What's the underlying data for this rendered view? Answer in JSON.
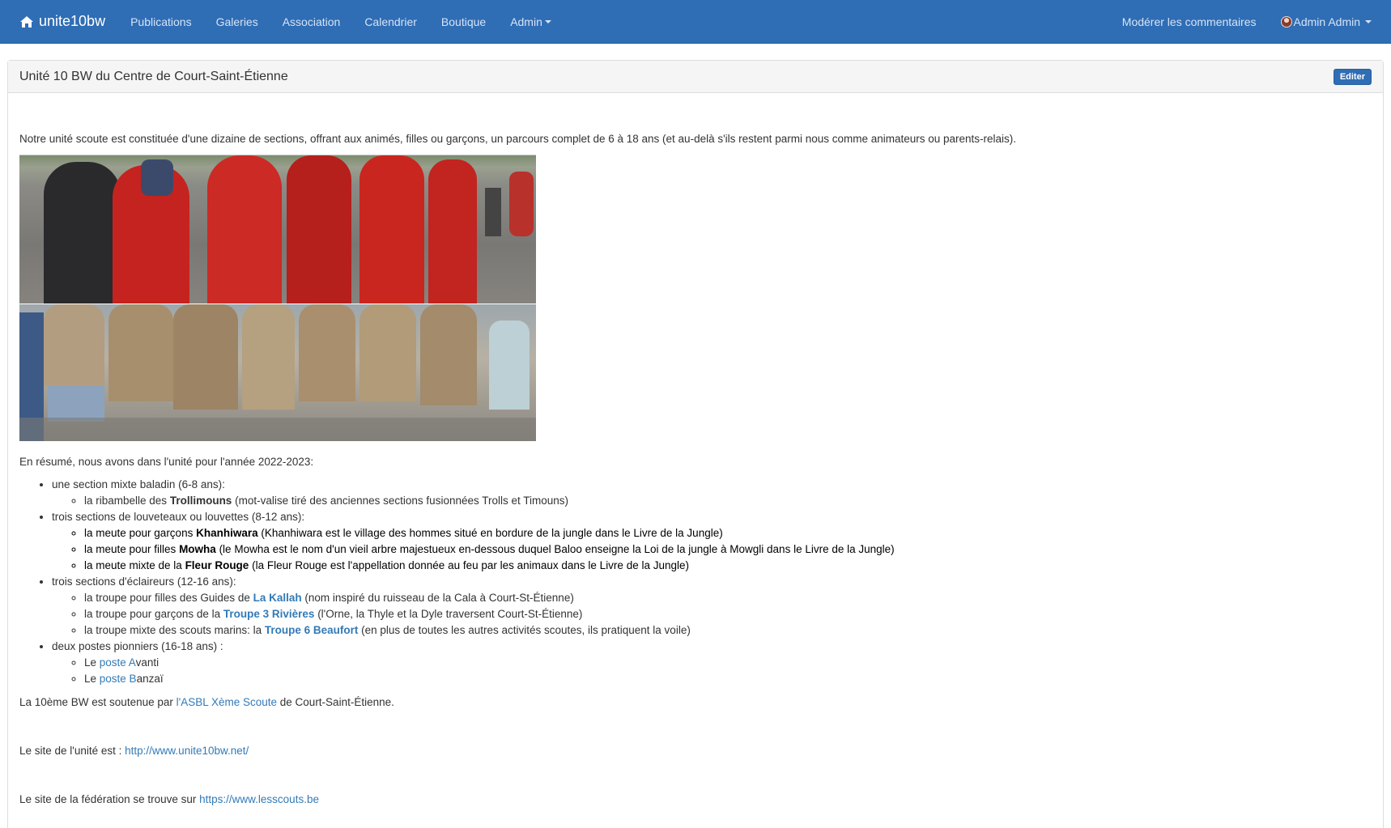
{
  "navbar": {
    "brand": "unite10bw",
    "items": [
      "Publications",
      "Galeries",
      "Association",
      "Calendrier",
      "Boutique",
      "Admin"
    ],
    "moderate": "Modérer les commentaires",
    "user": "Admin Admin"
  },
  "panel": {
    "title": "Unité 10 BW du Centre de Court-Saint-Étienne",
    "edit": "Editer"
  },
  "content": {
    "intro": "Notre unité scoute est constituée d'une dizaine de sections, offrant aux animés, filles ou garçons, un parcours complet de 6 à 18 ans (et au-delà s'ils restent parmi nous comme animateurs ou parents-relais).",
    "summary": "En résumé, nous avons dans l'unité pour l'année 2022-2023:",
    "sections": [
      {
        "label": "une section mixte baladin (6-8 ans):",
        "items": [
          {
            "pre": "la ribambelle des ",
            "name": "Trollimouns",
            "post": " (mot-valise tiré des anciennes sections fusionnées Trolls et Timouns)"
          }
        ]
      },
      {
        "label": "trois sections de louveteaux ou louvettes (8-12 ans):",
        "items": [
          {
            "pre": "la meute pour garçons ",
            "name": "Khanhiwara",
            "post": " (Khanhiwara est le village des hommes situé en bordure de la jungle dans le Livre de la Jungle)"
          },
          {
            "pre": "la meute pour filles ",
            "name": "Mowha",
            "post": " (le Mowha est le nom d'un vieil arbre majestueux en-dessous duquel Baloo enseigne la Loi de la jungle à Mowgli dans le Livre de la Jungle)"
          },
          {
            "pre": "la meute mixte de la ",
            "name": "Fleur Rouge",
            "post": " (la Fleur Rouge est l'appellation donnée au feu par les animaux dans le Livre de la Jungle)"
          }
        ]
      },
      {
        "label": "trois sections d'éclaireurs (12-16 ans):",
        "items": [
          {
            "pre": "la troupe pour filles des Guides de ",
            "name": "La Kallah",
            "post": " (nom inspiré du ruisseau de la Cala à Court-St-Étienne)"
          },
          {
            "pre": "la troupe pour garçons de la ",
            "name": "Troupe 3 Rivières",
            "post": " (l'Orne, la Thyle et la Dyle traversent Court-St-Étienne)"
          },
          {
            "pre": "la troupe mixte des scouts marins: la ",
            "name": "Troupe 6 Beaufort",
            "post": " (en plus de toutes les autres activités scoutes, ils pratiquent la voile)"
          }
        ]
      },
      {
        "label": "deux postes pionniers (16-18 ans) :",
        "items": [
          {
            "pre": "Le ",
            "link": "poste A",
            "post": "vanti"
          },
          {
            "pre": "Le ",
            "link": "poste B",
            "post": "anzaï"
          }
        ]
      }
    ],
    "asbl_pre": "La 10ème BW est soutenue par ",
    "asbl_link": "l'ASBL Xème Scoute",
    "asbl_post": " de Court-Saint-Étienne.",
    "site_pre": "Le site de l'unité est : ",
    "site_link": "http://www.unite10bw.net/",
    "fed_pre": "Le site de la fédération se trouve sur ",
    "fed_link": "https://www.lesscouts.be"
  },
  "colors": {
    "navbar": "#2f6db5",
    "link": "#337ab7"
  }
}
